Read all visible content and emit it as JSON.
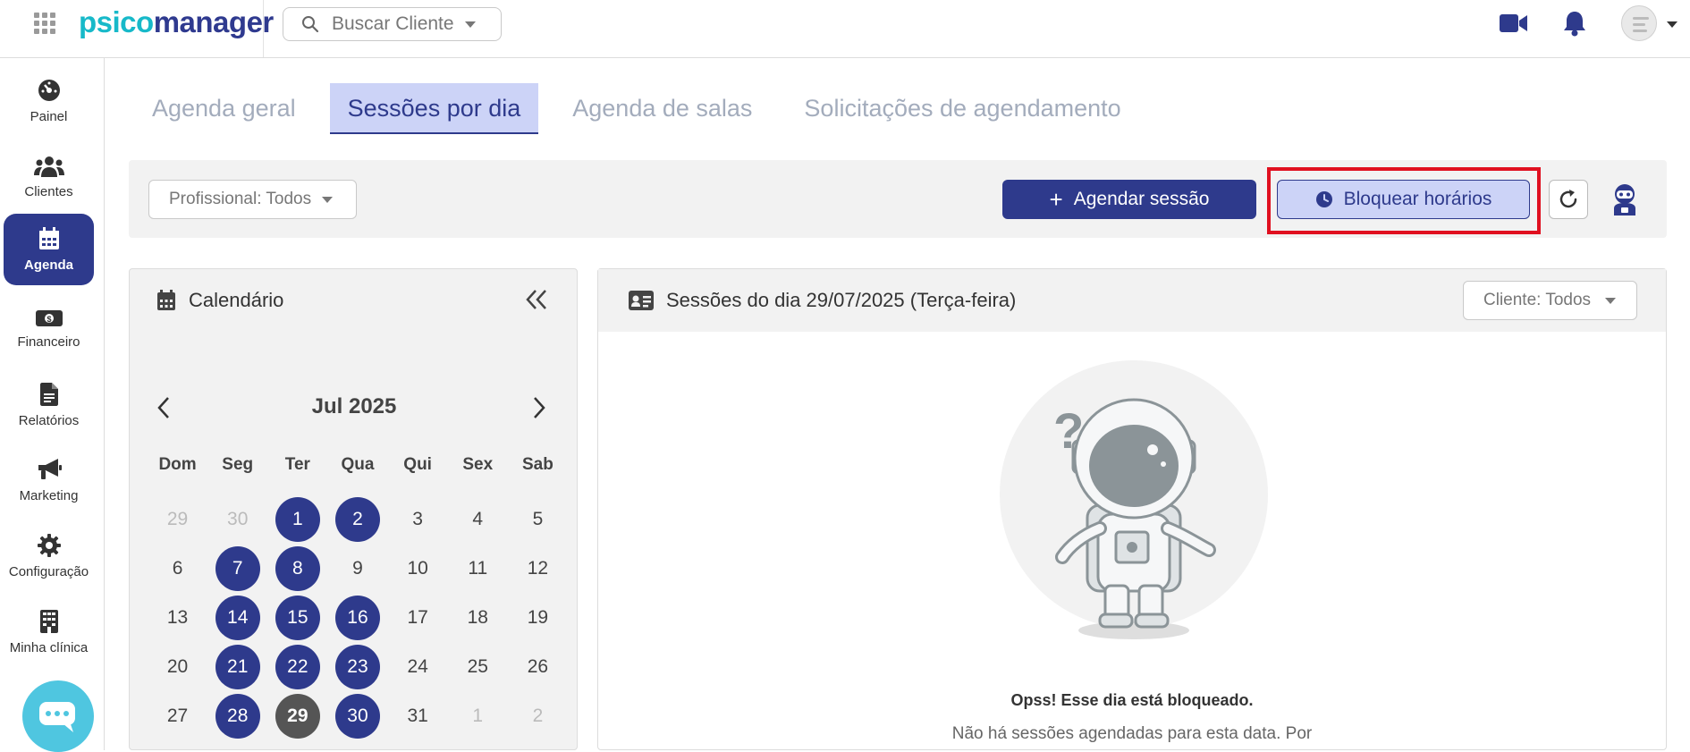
{
  "app": {
    "logo_part1": "psico",
    "logo_part2": "manager"
  },
  "search": {
    "label": "Buscar Cliente"
  },
  "sidebar": {
    "items": [
      {
        "label": "Painel",
        "icon": "gauge-icon"
      },
      {
        "label": "Clientes",
        "icon": "users-icon"
      },
      {
        "label": "Agenda",
        "icon": "calendar-icon",
        "active": true
      },
      {
        "label": "Financeiro",
        "icon": "money-icon"
      },
      {
        "label": "Relatórios",
        "icon": "file-icon"
      },
      {
        "label": "Marketing",
        "icon": "megaphone-icon"
      },
      {
        "label": "Configuração",
        "icon": "gear-icon"
      },
      {
        "label": "Minha clínica",
        "icon": "building-icon"
      }
    ]
  },
  "tabs": [
    {
      "label": "Agenda geral"
    },
    {
      "label": "Sessões por dia",
      "active": true
    },
    {
      "label": "Agenda de salas"
    },
    {
      "label": "Solicitações de agendamento"
    }
  ],
  "toolbar": {
    "professional_filter": "Profissional: Todos",
    "schedule_button": "Agendar sessão",
    "block_button": "Bloquear horários"
  },
  "calendar": {
    "title": "Calendário",
    "month_label": "Jul 2025",
    "weekdays": [
      "Dom",
      "Seg",
      "Ter",
      "Qua",
      "Qui",
      "Sex",
      "Sab"
    ],
    "days": [
      {
        "n": "29",
        "muted": true
      },
      {
        "n": "30",
        "muted": true
      },
      {
        "n": "1",
        "sess": true
      },
      {
        "n": "2",
        "sess": true
      },
      {
        "n": "3"
      },
      {
        "n": "4"
      },
      {
        "n": "5"
      },
      {
        "n": "6"
      },
      {
        "n": "7",
        "sess": true
      },
      {
        "n": "8",
        "sess": true
      },
      {
        "n": "9"
      },
      {
        "n": "10"
      },
      {
        "n": "11"
      },
      {
        "n": "12"
      },
      {
        "n": "13"
      },
      {
        "n": "14",
        "sess": true
      },
      {
        "n": "15",
        "sess": true
      },
      {
        "n": "16",
        "sess": true
      },
      {
        "n": "17"
      },
      {
        "n": "18"
      },
      {
        "n": "19"
      },
      {
        "n": "20"
      },
      {
        "n": "21",
        "sess": true
      },
      {
        "n": "22",
        "sess": true
      },
      {
        "n": "23",
        "sess": true
      },
      {
        "n": "24"
      },
      {
        "n": "25"
      },
      {
        "n": "26"
      },
      {
        "n": "27"
      },
      {
        "n": "28",
        "sess": true
      },
      {
        "n": "29",
        "today": true
      },
      {
        "n": "30",
        "sess": true
      },
      {
        "n": "31"
      },
      {
        "n": "1",
        "muted": true
      },
      {
        "n": "2",
        "muted": true
      }
    ]
  },
  "sessions": {
    "title": "Sessões do dia 29/07/2025 (Terça-feira)",
    "client_filter": "Cliente: Todos",
    "empty_title": "Opss! Esse dia está bloqueado.",
    "empty_text": "Não há sessões agendadas para esta data. Por"
  },
  "colors": {
    "primary": "#2e3a8c",
    "primary_light": "#ccd3f7",
    "accent": "#17b9c9",
    "highlight": "#e01020"
  }
}
